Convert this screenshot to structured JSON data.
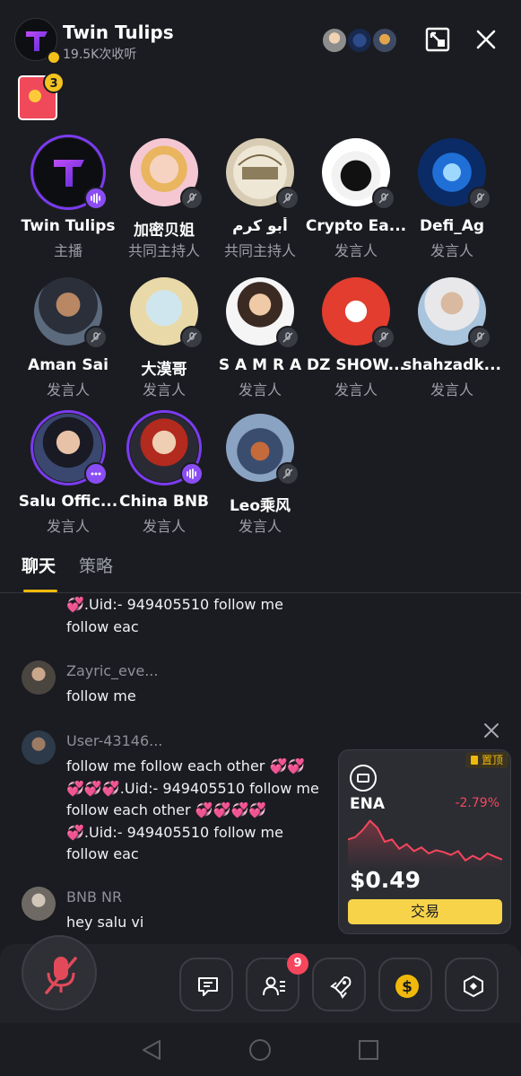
{
  "header": {
    "room_name": "Twin Tulips",
    "listeners": "19.5K次收听",
    "red_packet_count": "3"
  },
  "speakers": [
    {
      "name": "Twin Tulips",
      "role": "主播"
    },
    {
      "name": "加密贝姐",
      "role": "共同主持人"
    },
    {
      "name": "أبو كرم",
      "role": "共同主持人"
    },
    {
      "name": "Crypto Ea...",
      "role": "发言人"
    },
    {
      "name": "Defi_Ag",
      "role": "发言人"
    },
    {
      "name": "Aman Sai",
      "role": "发言人"
    },
    {
      "name": "大漠哥",
      "role": "发言人"
    },
    {
      "name": "S A M R A",
      "role": "发言人"
    },
    {
      "name": "DZ SHOW...",
      "role": "发言人"
    },
    {
      "name": "shahzadk...",
      "role": "发言人"
    },
    {
      "name": "Salu Offic...",
      "role": "发言人"
    },
    {
      "name": "China BNB",
      "role": "发言人"
    },
    {
      "name": "Leo乘风",
      "role": "发言人"
    }
  ],
  "tabs": {
    "chat": "聊天",
    "strategy": "策略"
  },
  "chat": [
    {
      "user": "",
      "text": "💞.Uid:- 949405510 follow me follow eac"
    },
    {
      "user": "Zayric_eve...",
      "text": "follow me"
    },
    {
      "user": "User-43146...",
      "text": "follow me follow each other 💞💞💞💞💞.Uid:- 949405510 follow me follow each other 💞💞💞💞💞.Uid:- 949405510 follow me follow eac"
    },
    {
      "user": "BNB NR",
      "text": "hey salu vi"
    }
  ],
  "ticker": {
    "pin_label": "置顶",
    "symbol": "ENA",
    "change": "-2.79%",
    "price": "$0.49",
    "trade_label": "交易",
    "sparkline": [
      0.55,
      0.6,
      0.75,
      0.95,
      0.8,
      0.5,
      0.55,
      0.35,
      0.45,
      0.3,
      0.38,
      0.25,
      0.32,
      0.28,
      0.22,
      0.3,
      0.1,
      0.2,
      0.12,
      0.25,
      0.18,
      0.12
    ]
  },
  "bottom_bar": {
    "participants_badge": "9"
  },
  "colors": {
    "accent": "#f0b90b",
    "negative": "#f6465d",
    "live_ring": "#7b3bf0",
    "background": "#1b1c21"
  }
}
